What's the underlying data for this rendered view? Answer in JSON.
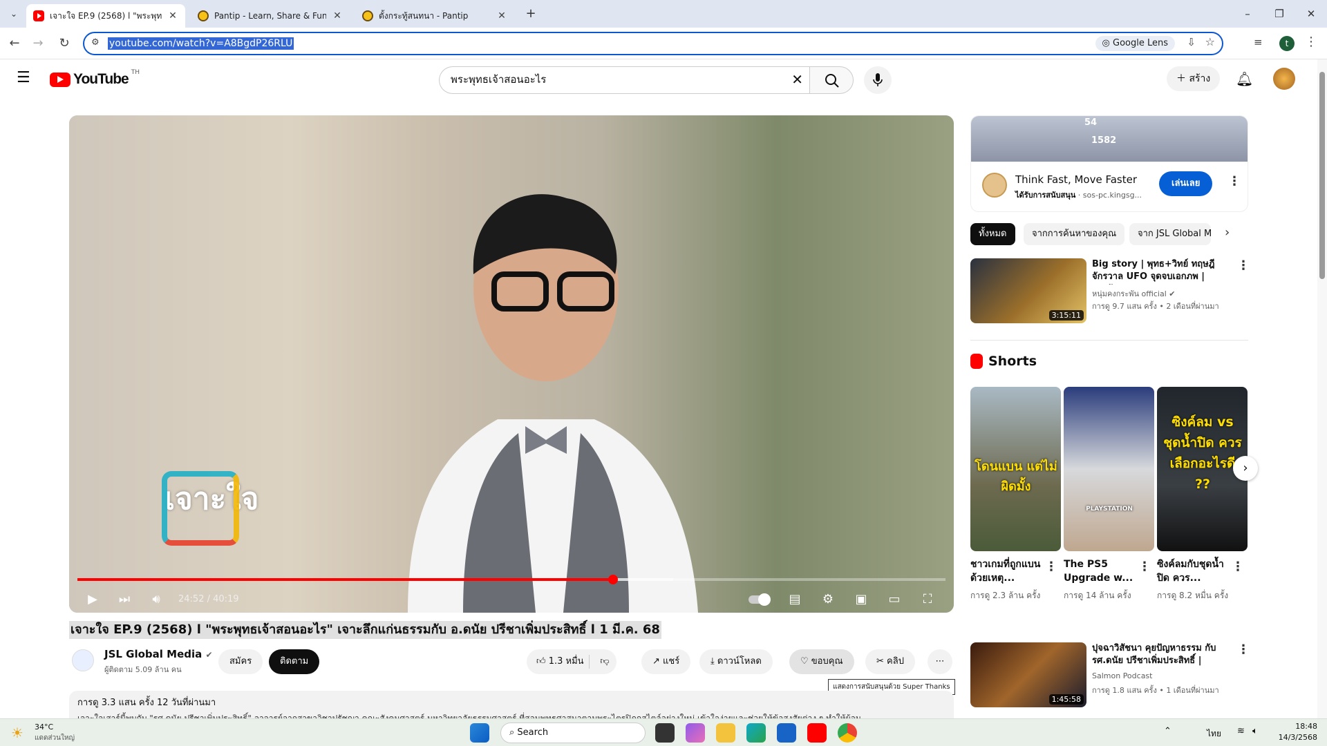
{
  "browser": {
    "tabs": [
      {
        "title": "เจาะใจ EP.9 (2568) l \"พระพุทธเจ้าส",
        "active": true
      },
      {
        "title": "Pantip - Learn, Share & Fun",
        "active": false
      },
      {
        "title": "ตั้งกระทู้สนทนา - Pantip",
        "active": false
      }
    ],
    "new_tab": "+",
    "url": "youtube.com/watch?v=A8BgdP26RLU",
    "lens_label": "Google Lens",
    "profile_initial": "t"
  },
  "yt": {
    "logo_text": "YouTube",
    "country_code": "TH",
    "search_value": "พระพุทธเจ้าสอนอะไร",
    "create_label": "สร้าง"
  },
  "player": {
    "time": "24:52 / 40:19",
    "progress_fraction": 0.617,
    "buffer_fraction": 0.686,
    "watermark": "เจาะใจ"
  },
  "video": {
    "title": "เจาะใจ EP.9 (2568) l \"พระพุทธเจ้าสอนอะไร\" เจาะลึกแก่นธรรมกับ อ.ดนัย ปรีชาเพิ่มประสิทธิ์ l 1 มี.ค. 68",
    "channel": "JSL Global Media",
    "subscribers": "ผู้ติดตาม 5.09 ล้าน คน",
    "join_label": "สมัคร",
    "subscribe_label": "ติดตาม",
    "likes": "1.3 หมื่น",
    "share_label": "แชร์",
    "download_label": "ดาวน์โหลด",
    "thanks_label": "ขอบคุณ",
    "clip_label": "คลิป",
    "tooltip": "แสดงการสนับสนุนด้วย Super Thanks",
    "desc_stats": "การดู 3.3 แสน ครั้ง  12 วันที่ผ่านมา",
    "desc_text": "เจาะใจเสาร์นี้พบกับ \"รศ.ดนัย ปรีชาเพิ่มประสิทธิ์\" อาจารย์จากสาขาวิชาปรัชญา คณะสังคมศาสตร์ มหาวิทยาลัยธรรมศาสตร์ ที่สอนพุทธศาสนาตามพระไตรปิฎกสไตล์อย่างใหม่ เข้าใจง่ายและช่วยให้ข้อสงสัยต่าง ๆ ทำให้ผ้อน"
  },
  "ad": {
    "title": "Think Fast, Move Faster",
    "sponsored": "ได้รับการสนับสนุน",
    "domain": "sos-pc.kingsg...",
    "cta": "เล่นเลย",
    "thumb_numbers": [
      "54",
      "1582"
    ]
  },
  "chips": [
    "ทั้งหมด",
    "จากการค้นหาของคุณ",
    "จาก JSL Global M"
  ],
  "recs": [
    {
      "title": "Big story | พุทธ+วิทย์ ทฤษฎีจักรวาล UFO จุดจบเอกภพ | อ.ดนั...",
      "channel": "หนุ่มคงกระพัน official",
      "meta": "การดู 9.7 แสน ครั้ง  • 2 เดือนที่ผ่านมา",
      "duration": "3:15:11"
    },
    {
      "title": "ปุจฉาวิสัชนา คุยปัญหาธรรม กับ รศ.ดนัย ปรีชาเพิ่มประสิทธิ์ | Myth...",
      "channel": "Salmon Podcast",
      "meta": "การดู 1.8 แสน ครั้ง  • 1 เดือนที่ผ่านมา",
      "duration": "1:45:58"
    }
  ],
  "shorts": {
    "heading": "Shorts",
    "items": [
      {
        "title": "ชาวเกมที่ถูกแบนด้วยเหตุ...",
        "views": "การดู 2.3 ล้าน ครั้ง",
        "caption": "โดนแบน แต่ไม่ผิดมั้ง"
      },
      {
        "title": "The PS5 Upgrade w...",
        "views": "การดู 14 ล้าน ครั้ง",
        "caption": "PLAYSTATION"
      },
      {
        "title": "ซิงค์ลมกับชุดน้ำปิด ควร...",
        "views": "การดู 8.2 หมื่น ครั้ง",
        "caption": "ซิงค์ลม vs ชุดน้ำปิด ควรเลือกอะไรดี ??"
      }
    ]
  },
  "taskbar": {
    "temp": "34°C",
    "weather": "แดดส่วนใหญ่",
    "search": "Search",
    "lang": "ไทย",
    "time": "18:48",
    "date": "14/3/2568"
  },
  "colors": {
    "accent": "#065fd4",
    "yt_red": "#ff0000"
  }
}
